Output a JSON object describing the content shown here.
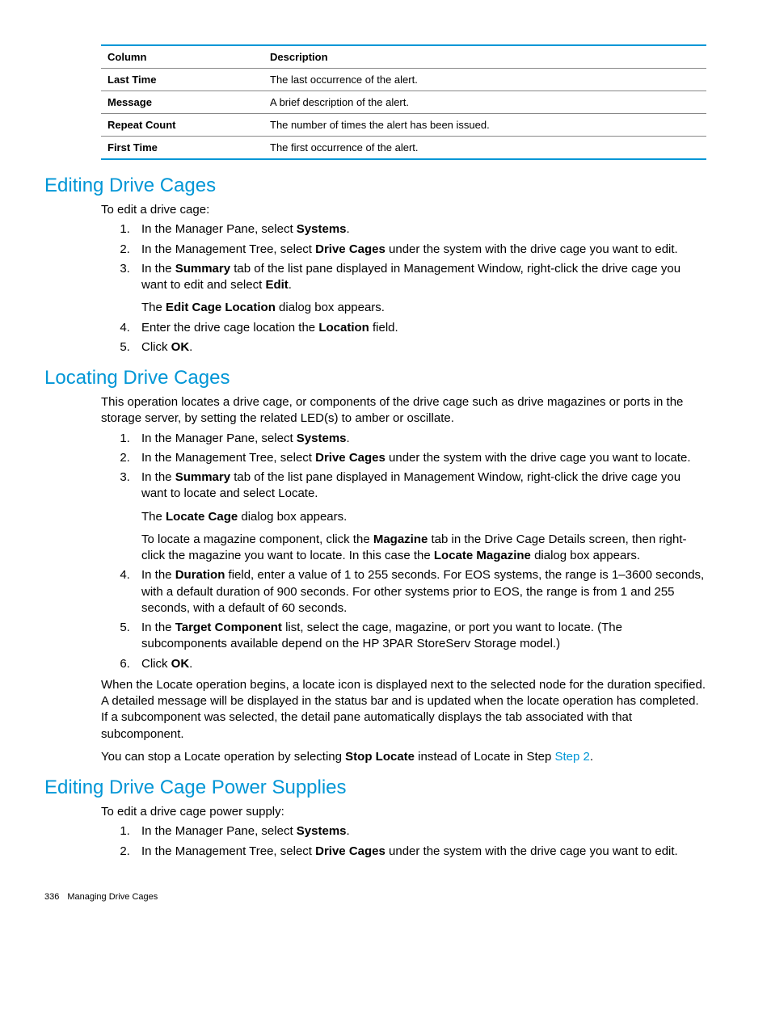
{
  "table": {
    "headers": [
      "Column",
      "Description"
    ],
    "rows": [
      {
        "col": "Last Time",
        "desc": "The last occurrence of the alert."
      },
      {
        "col": "Message",
        "desc": "A brief description of the alert."
      },
      {
        "col": "Repeat Count",
        "desc": "The number of times the alert has been issued."
      },
      {
        "col": "First Time",
        "desc": "The first occurrence of the alert."
      }
    ]
  },
  "sections": {
    "editCages": {
      "heading": "Editing Drive Cages",
      "intro": "To edit a drive cage:",
      "steps": {
        "s1_a": "In the Manager Pane, select ",
        "s1_b": "Systems",
        "s1_c": ".",
        "s2_a": "In the Management Tree, select ",
        "s2_b": "Drive Cages",
        "s2_c": " under the system with the drive cage you want to edit.",
        "s3_a": "In the ",
        "s3_b": "Summary",
        "s3_c": " tab of the list pane displayed in Management Window, right-click the drive cage you want to edit and select ",
        "s3_d": "Edit",
        "s3_e": ".",
        "s3_sub_a": "The ",
        "s3_sub_b": "Edit Cage Location",
        "s3_sub_c": " dialog box appears.",
        "s4_a": "Enter the drive cage location the ",
        "s4_b": "Location",
        "s4_c": " field.",
        "s5_a": "Click ",
        "s5_b": "OK",
        "s5_c": "."
      }
    },
    "locateCages": {
      "heading": "Locating Drive Cages",
      "intro": "This operation locates a drive cage, or components of the drive cage such as drive magazines or ports in the storage server, by setting the related LED(s) to amber or oscillate.",
      "steps": {
        "s1_a": "In the Manager Pane, select ",
        "s1_b": "Systems",
        "s1_c": ".",
        "s2_a": "In the Management Tree, select ",
        "s2_b": "Drive Cages",
        "s2_c": " under the system with the drive cage you want to locate.",
        "s3_a": "In the ",
        "s3_b": "Summary",
        "s3_c": " tab of the list pane displayed in Management Window, right-click the drive cage you want to locate and select Locate.",
        "s3_sub1_a": "The ",
        "s3_sub1_b": "Locate Cage",
        "s3_sub1_c": " dialog box appears.",
        "s3_sub2_a": "To locate a magazine component, click the ",
        "s3_sub2_b": "Magazine",
        "s3_sub2_c": " tab in the Drive Cage Details screen, then right-click the magazine you want to locate. In this case the ",
        "s3_sub2_d": "Locate Magazine",
        "s3_sub2_e": " dialog box appears.",
        "s4_a": "In the ",
        "s4_b": "Duration",
        "s4_c": " field, enter a value of 1 to 255 seconds. For EOS systems, the range is 1–3600 seconds, with a default duration of 900 seconds. For other systems prior to EOS, the range is from 1 and 255 seconds, with a default of 60 seconds.",
        "s5_a": "In the ",
        "s5_b": "Target Component",
        "s5_c": " list, select the cage, magazine, or port you want to locate. (The subcomponents available depend on the HP 3PAR StoreServ Storage model.)",
        "s6_a": "Click ",
        "s6_b": "OK",
        "s6_c": "."
      },
      "after1": "When the Locate operation begins, a locate icon is displayed next to the selected node for the duration specified. A detailed message will be displayed in the status bar and is updated when the locate operation has completed. If a subcomponent was selected, the detail pane automatically displays the tab associated with that subcomponent.",
      "after2_a": "You can stop a Locate operation by selecting ",
      "after2_b": "Stop Locate",
      "after2_c": " instead of Locate in Step ",
      "after2_link": "Step 2",
      "after2_d": "."
    },
    "editPower": {
      "heading": "Editing Drive Cage Power Supplies",
      "intro": "To edit a drive cage power supply:",
      "steps": {
        "s1_a": "In the Manager Pane, select ",
        "s1_b": "Systems",
        "s1_c": ".",
        "s2_a": "In the Management Tree, select ",
        "s2_b": "Drive Cages",
        "s2_c": " under the system with the drive cage you want to edit."
      }
    }
  },
  "footer": {
    "page": "336",
    "title": "Managing Drive Cages"
  }
}
